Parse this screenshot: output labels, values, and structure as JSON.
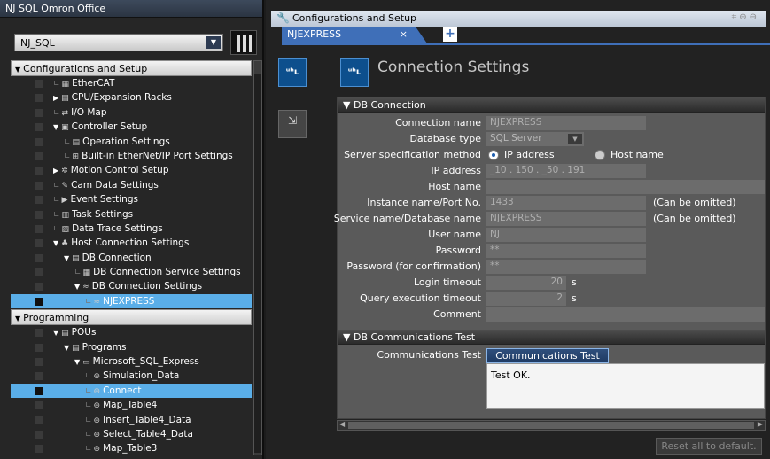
{
  "left_panel": {
    "title": "NJ SQL Omron Office",
    "project_select": "NJ_SQL",
    "config_section": "Configurations and Setup",
    "programming_section": "Programming",
    "config_items": [
      {
        "label": "EtherCAT",
        "icon": "ethercat-icon",
        "glyph": "▦"
      },
      {
        "label": "CPU/Expansion Racks",
        "icon": "rack-icon",
        "glyph": "▤"
      },
      {
        "label": "I/O Map",
        "icon": "io-map-icon",
        "glyph": "⇄"
      },
      {
        "label": "Controller Setup",
        "icon": "controller-icon",
        "glyph": "▣"
      },
      {
        "label": "Operation Settings",
        "icon": "operation-settings-icon",
        "glyph": "▤"
      },
      {
        "label": "Built-in EtherNet/IP Port Settings",
        "icon": "ethernet-port-icon",
        "glyph": "⊞"
      },
      {
        "label": "Motion Control Setup",
        "icon": "motion-icon",
        "glyph": "✲"
      },
      {
        "label": "Cam Data Settings",
        "icon": "cam-icon",
        "glyph": "✎"
      },
      {
        "label": "Event Settings",
        "icon": "event-icon",
        "glyph": "▶"
      },
      {
        "label": "Task Settings",
        "icon": "task-icon",
        "glyph": "▥"
      },
      {
        "label": "Data Trace Settings",
        "icon": "trace-icon",
        "glyph": "▨"
      },
      {
        "label": "Host Connection Settings",
        "icon": "host-icon",
        "glyph": "♣"
      },
      {
        "label": "DB Connection",
        "icon": "db-connection-icon",
        "glyph": "▤"
      },
      {
        "label": "DB Connection Service Settings",
        "icon": "db-service-icon",
        "glyph": "▦"
      },
      {
        "label": "DB Connection Settings",
        "icon": "db-settings-icon",
        "glyph": "≈"
      },
      {
        "label": "NJEXPRESS",
        "icon": "connection-icon",
        "glyph": "≈"
      }
    ],
    "prog_items": [
      {
        "label": "POUs",
        "icon": "pous-icon",
        "glyph": "▤"
      },
      {
        "label": "Programs",
        "icon": "programs-icon",
        "glyph": "▤"
      },
      {
        "label": "Microsoft_SQL_Express",
        "icon": "program-icon",
        "glyph": "▭"
      },
      {
        "label": "Simulation_Data",
        "icon": "section-icon",
        "glyph": "⊕"
      },
      {
        "label": "Connect",
        "icon": "section-icon",
        "glyph": "⊕"
      },
      {
        "label": "Map_Table4",
        "icon": "section-icon",
        "glyph": "⊕"
      },
      {
        "label": "Insert_Table4_Data",
        "icon": "section-icon",
        "glyph": "⊕"
      },
      {
        "label": "Select_Table4_Data",
        "icon": "section-icon",
        "glyph": "⊕"
      },
      {
        "label": "Map_Table3",
        "icon": "section-icon",
        "glyph": "⊕"
      }
    ]
  },
  "editor": {
    "title": "Configurations and Setup",
    "tab_label": "NJEXPRESS",
    "tab_close": "×",
    "tab_add": "+",
    "page_title": "Connection Settings",
    "icon_glyph": "ᵘʰʟ",
    "db_connection_header": "DB Connection",
    "fields": {
      "connection_name_label": "Connection name",
      "connection_name_value": "NJEXPRESS",
      "database_type_label": "Database type",
      "database_type_value": "SQL Server",
      "server_spec_label": "Server specification method",
      "server_spec_ip": "IP address",
      "server_spec_host": "Host name",
      "ip_label": "IP address",
      "ip_value": "_10 . 150 . _50 . 191",
      "host_label": "Host name",
      "host_value": "",
      "instance_label": "Instance name/Port No.",
      "instance_value": "1433",
      "instance_note": "(Can be omitted)",
      "service_label": "Service name/Database name",
      "service_value": "NJEXPRESS",
      "service_note": "(Can be omitted)",
      "user_label": "User name",
      "user_value": "NJ",
      "password_label": "Password",
      "password_value": "**",
      "password_confirm_label": "Password (for confirmation)",
      "password_confirm_value": "**",
      "login_timeout_label": "Login timeout",
      "login_timeout_value": "20",
      "login_timeout_unit": "s",
      "query_timeout_label": "Query execution timeout",
      "query_timeout_value": "2",
      "query_timeout_unit": "s",
      "comment_label": "Comment",
      "comment_value": ""
    },
    "comm_test_header": "DB Communications Test",
    "comm_test_label": "Communications Test",
    "comm_test_button": "Communications Test",
    "test_result": "Test OK.",
    "reset_button": "Reset all to default."
  }
}
